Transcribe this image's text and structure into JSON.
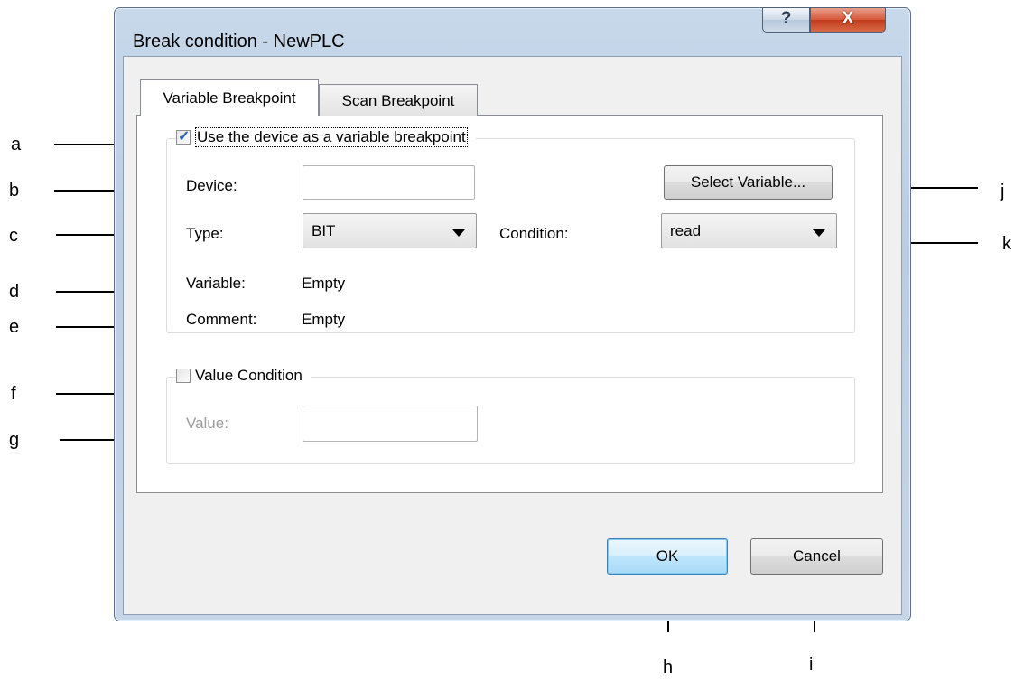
{
  "dialog": {
    "title": "Break condition - NewPLC",
    "help_glyph": "?",
    "close_glyph": "X"
  },
  "tabs": [
    {
      "label": "Variable Breakpoint",
      "active": true
    },
    {
      "label": "Scan Breakpoint",
      "active": false
    }
  ],
  "variable_group": {
    "checkbox_label": "Use the device as a variable breakpoint",
    "checked": true,
    "device_label": "Device:",
    "device_value": "",
    "type_label": "Type:",
    "type_value": "BIT",
    "condition_label": "Condition:",
    "condition_value": "read",
    "variable_label": "Variable:",
    "variable_value": "Empty",
    "comment_label": "Comment:",
    "comment_value": "Empty",
    "select_variable_label": "Select Variable..."
  },
  "value_group": {
    "checkbox_label": "Value Condition",
    "checked": false,
    "value_label": "Value:",
    "value_value": ""
  },
  "buttons": {
    "ok": "OK",
    "cancel": "Cancel"
  },
  "annotations": [
    "a",
    "b",
    "c",
    "d",
    "e",
    "f",
    "g",
    "h",
    "i",
    "j",
    "k"
  ],
  "colors": {
    "window_frame": "#b9cde3",
    "close_button": "#c13a1c",
    "default_button_border": "#3c7fb1"
  }
}
